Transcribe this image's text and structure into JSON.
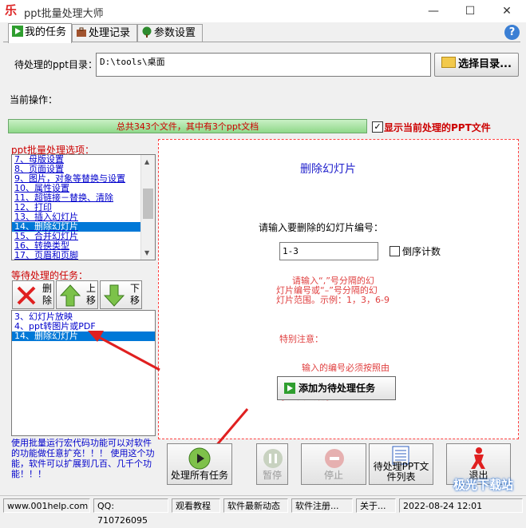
{
  "window": {
    "app_icon": "乐",
    "title": "ppt批量处理大师"
  },
  "tabs": [
    {
      "label": "我的任务",
      "icon": "play-icon"
    },
    {
      "label": "处理记录",
      "icon": "briefcase-icon"
    },
    {
      "label": "参数设置",
      "icon": "tree-icon"
    }
  ],
  "dir": {
    "label": "待处理的ppt目录：",
    "value": "D:\\tools\\桌面",
    "button": "选择目录..."
  },
  "current_op_label": "当前操作：",
  "progress": {
    "text": "总共343个文件，其中有3个ppt文档",
    "value": 1.0
  },
  "show_current": {
    "label": "显示当前处理的PPT文件",
    "checked": true
  },
  "options": {
    "label": "ppt批量处理选项：",
    "items": [
      "7、母版设置",
      "8、页面设置",
      "9、图片，对象等替换与设置",
      "10、属性设置",
      "11、超链接－替换、清除",
      "12、打印",
      "13、插入幻灯片",
      "14、删除幻灯片",
      "15、合并幻灯片",
      "16、转换类型",
      "17、页眉和页脚"
    ],
    "selected_index": 7
  },
  "pending": {
    "label": "等待处理的任务：",
    "delete": "删除",
    "up": "上移",
    "down": "下移",
    "items": [
      "3、幻灯片放映",
      "4、ppt转图片或PDF",
      "14、删除幻灯片"
    ],
    "selected_index": 2
  },
  "tip": "使用批量运行宏代码功能可以对软件的功能做任意扩充！！！     使用这个功能，软件可以扩展到几百、几千个功能！！！",
  "panel": {
    "title": "删除幻灯片",
    "prompt": "请输入要删除的幻灯片编号：",
    "input_value": "1-3",
    "reverse_label": "倒序计数",
    "reverse_checked": false,
    "hint1": [
      "请输入“,”号分隔的幻",
      "灯片编号或“–”号分隔的幻",
      "灯片范围。示例：1，3，6-9"
    ],
    "hint2": [
      "特别注意：",
      "        输入的编号必须按照由",
      "小到大的顺序"
    ],
    "add_button": "添加为待处理任务"
  },
  "buttons": {
    "process_all": "处理所有任务",
    "pause": "暂停",
    "stop": "停止",
    "pending_list": "待处理PPT文件列表",
    "exit": "退出"
  },
  "status": {
    "site": "www.001help.com",
    "qq": "QQ: 710726095",
    "tutorial": "观看教程",
    "news": "软件最新动态",
    "register": "软件注册...",
    "about": "关于...",
    "datetime": "2022-08-24   12:01"
  },
  "watermark": "极光下载站",
  "colors": {
    "accent_red": "#cc0000",
    "list_blue": "#0000cc",
    "selection": "#0078d7",
    "panel_border": "#ff4040"
  }
}
